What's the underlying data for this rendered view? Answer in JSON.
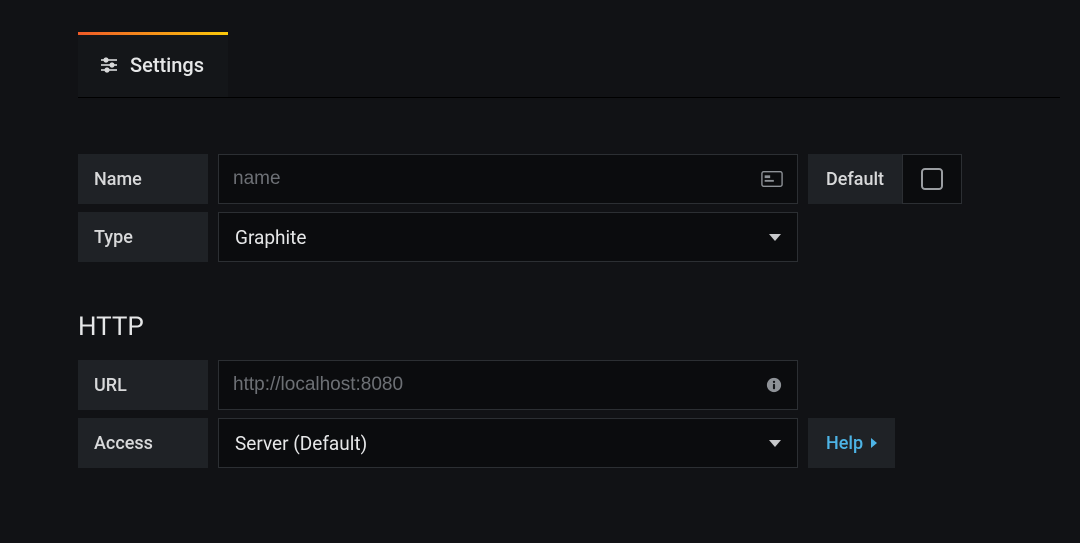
{
  "tabs": {
    "settings_label": "Settings"
  },
  "form": {
    "name": {
      "label": "Name",
      "value": "",
      "placeholder": "name"
    },
    "default": {
      "label": "Default",
      "checked": false
    },
    "type": {
      "label": "Type",
      "selected": "Graphite"
    }
  },
  "http_section": {
    "title": "HTTP",
    "url": {
      "label": "URL",
      "value": "",
      "placeholder": "http://localhost:8080"
    },
    "access": {
      "label": "Access",
      "selected": "Server (Default)",
      "help_label": "Help"
    }
  }
}
